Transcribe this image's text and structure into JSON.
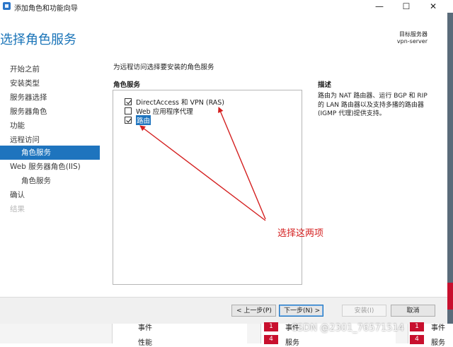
{
  "window": {
    "title": "添加角色和功能向导",
    "controls": {
      "minimize": "—",
      "maximize": "☐",
      "close": "✕"
    }
  },
  "header": {
    "page_title": "选择角色服务",
    "target_label": "目标服务器",
    "target_server": "vpn-server"
  },
  "nav": {
    "items": [
      {
        "label": "开始之前",
        "level": 0,
        "state": "normal"
      },
      {
        "label": "安装类型",
        "level": 0,
        "state": "normal"
      },
      {
        "label": "服务器选择",
        "level": 0,
        "state": "normal"
      },
      {
        "label": "服务器角色",
        "level": 0,
        "state": "normal"
      },
      {
        "label": "功能",
        "level": 0,
        "state": "normal"
      },
      {
        "label": "远程访问",
        "level": 0,
        "state": "normal"
      },
      {
        "label": "角色服务",
        "level": 1,
        "state": "active"
      },
      {
        "label": "Web 服务器角色(IIS)",
        "level": 0,
        "state": "normal"
      },
      {
        "label": "角色服务",
        "level": 1,
        "state": "normal"
      },
      {
        "label": "确认",
        "level": 0,
        "state": "normal"
      },
      {
        "label": "结果",
        "level": 0,
        "state": "disabled"
      }
    ]
  },
  "main": {
    "hint": "为远程访问选择要安装的角色服务",
    "column_label": "角色服务",
    "roles": [
      {
        "label": "DirectAccess 和 VPN (RAS)",
        "checked": true,
        "selected": false
      },
      {
        "label": "Web 应用程序代理",
        "checked": false,
        "selected": false
      },
      {
        "label": "路由",
        "checked": true,
        "selected": true
      }
    ],
    "description_label": "描述",
    "description_text": "路由为 NAT 路由器、运行 BGP 和 RIP 的 LAN 路由器以及支持多播的路由器(IGMP 代理)提供支持。"
  },
  "annotation": {
    "text": "选择这两项",
    "color": "#d41f1f"
  },
  "footer": {
    "prev_label": "< 上一步(P)",
    "next_label": "下一步(N) >",
    "install_label": "安装(I)",
    "cancel_label": "取消"
  },
  "background": {
    "left_items": [
      "事件",
      "性能"
    ],
    "right_counts": [
      "1",
      "4"
    ],
    "right_labels": [
      "事件",
      "服务"
    ],
    "far_counts": [
      "1",
      "4"
    ],
    "far_labels": [
      "事件",
      "服务"
    ]
  },
  "watermark": "CSDN @2301_76571514",
  "colors": {
    "accent": "#1e74be",
    "title_blue": "#1a74b8",
    "badge_red": "#c8102e"
  }
}
